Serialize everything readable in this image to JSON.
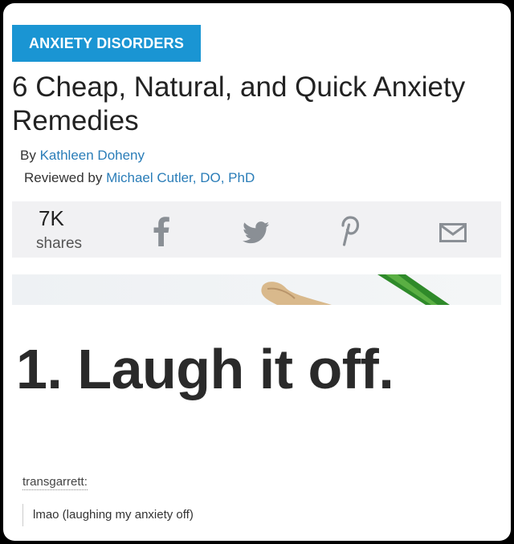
{
  "article": {
    "category": "ANXIETY DISORDERS",
    "title": "6 Cheap, Natural, and Quick Anxiety Remedies",
    "byline_prefix": "By",
    "author": "Kathleen Doheny",
    "reviewed_prefix": "Reviewed by",
    "reviewer": "Michael Cutler, DO, PhD",
    "step_heading": "1. Laugh it off."
  },
  "share": {
    "count": "7K",
    "label": "shares",
    "icons": [
      "facebook-icon",
      "twitter-icon",
      "pinterest-icon",
      "email-icon"
    ],
    "icon_color": "#8a8f95"
  },
  "tumblr": {
    "username": "transgarrett:",
    "reply": "lmao (laughing my anxiety off)"
  },
  "colors": {
    "accent": "#1a95d3",
    "link": "#2a7db8",
    "share_bar_bg": "#f1f1f3",
    "frame": "#000000"
  }
}
